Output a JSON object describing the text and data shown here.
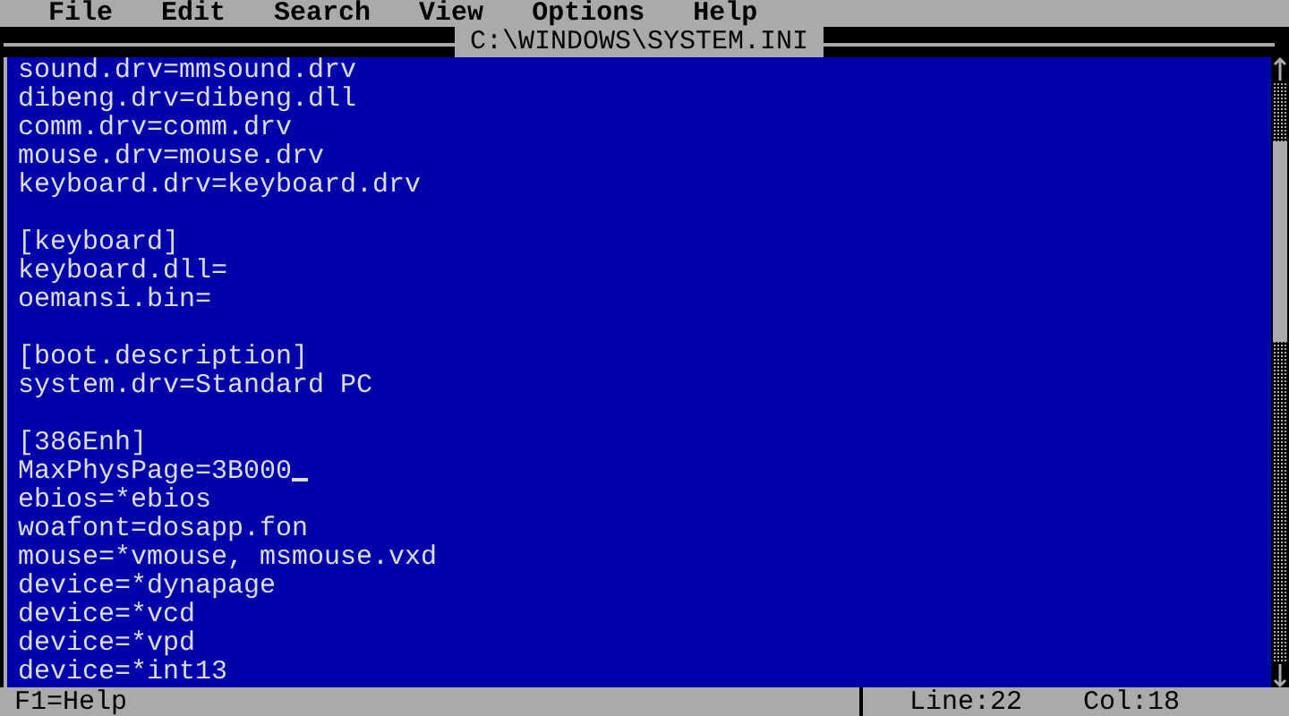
{
  "menu": [
    "File",
    "Edit",
    "Search",
    "View",
    "Options",
    "Help"
  ],
  "document": {
    "title": "C:\\WINDOWS\\SYSTEM.INI",
    "lines": [
      {
        "text": "sound.drv=mmsound.drv",
        "cursor": false
      },
      {
        "text": "dibeng.drv=dibeng.dll",
        "cursor": false
      },
      {
        "text": "comm.drv=comm.drv",
        "cursor": false
      },
      {
        "text": "mouse.drv=mouse.drv",
        "cursor": false
      },
      {
        "text": "keyboard.drv=keyboard.drv",
        "cursor": false
      },
      {
        "cursor": false
      },
      {
        "text": "[keyboard]",
        "cursor": false
      },
      {
        "text": "keyboard.dll=",
        "cursor": false
      },
      {
        "text": "oemansi.bin=",
        "cursor": false
      },
      {
        "cursor": false
      },
      {
        "text": "[boot.description]",
        "cursor": false
      },
      {
        "text": "system.drv=Standard PC",
        "cursor": false
      },
      {
        "cursor": false
      },
      {
        "text": "[386Enh]",
        "cursor": false
      },
      {
        "text": "MaxPhysPage=3B000",
        "cursor": true
      },
      {
        "text": "ebios=*ebios",
        "cursor": false
      },
      {
        "text": "woafont=dosapp.fon",
        "cursor": false
      },
      {
        "text": "mouse=*vmouse, msmouse.vxd",
        "cursor": false
      },
      {
        "text": "device=*dynapage",
        "cursor": false
      },
      {
        "text": "device=*vcd",
        "cursor": false
      },
      {
        "text": "device=*vpd",
        "cursor": false
      },
      {
        "text": "device=*int13",
        "cursor": false
      }
    ]
  },
  "status_bar": {
    "help": "F1=Help",
    "line": "Line:22",
    "column": "Col:18"
  }
}
